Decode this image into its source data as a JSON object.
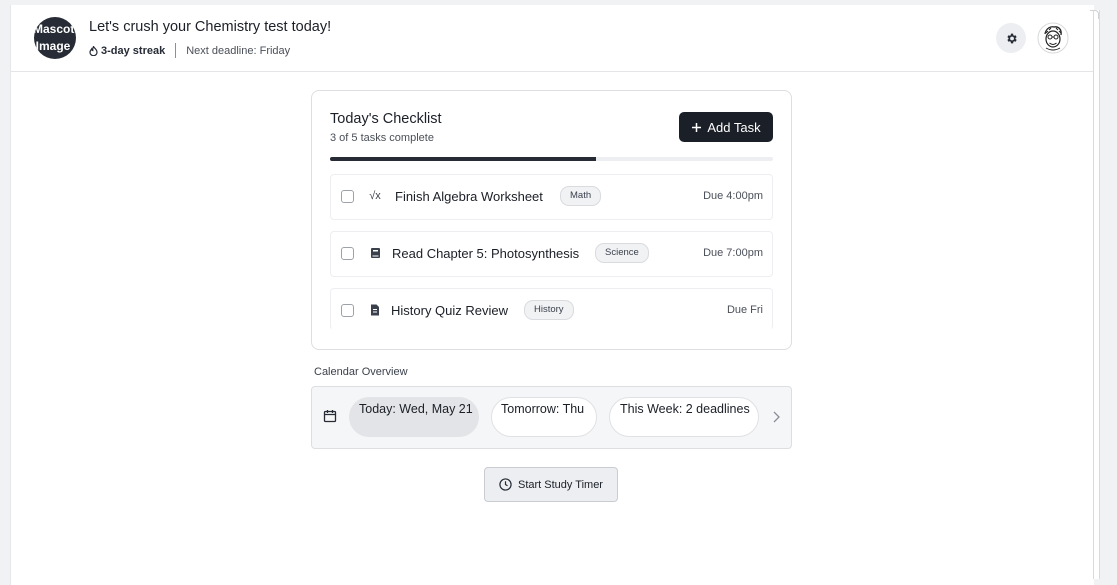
{
  "header": {
    "mascot_text": "Mascot Image",
    "greeting": "Let's crush your Chemistry test today!",
    "streak": "3-day streak",
    "deadline": "Next deadline: Friday"
  },
  "checklist": {
    "title": "Today's Checklist",
    "subtitle": "3 of 5 tasks complete",
    "add_button": "Add Task",
    "progress_fraction": 0.6,
    "tasks": [
      {
        "icon": "sqrt-icon",
        "name": "Finish Algebra Worksheet",
        "tag": "Math",
        "due": "Due 4:00pm"
      },
      {
        "icon": "book-icon",
        "name": "Read Chapter 5: Photosynthesis",
        "tag": "Science",
        "due": "Due 7:00pm"
      },
      {
        "icon": "document-icon",
        "name": "History Quiz Review",
        "tag": "History",
        "due": "Due Fri"
      }
    ]
  },
  "calendar": {
    "label": "Calendar Overview",
    "today": "Today: Wed, May 21",
    "tomorrow": "Tomorrow: Thu",
    "week": "This Week: 2 deadlines"
  },
  "timer_button": "Start Study Timer",
  "colors": {
    "primary": "#1b1f27",
    "accent_bg": "#f1f2f4"
  }
}
